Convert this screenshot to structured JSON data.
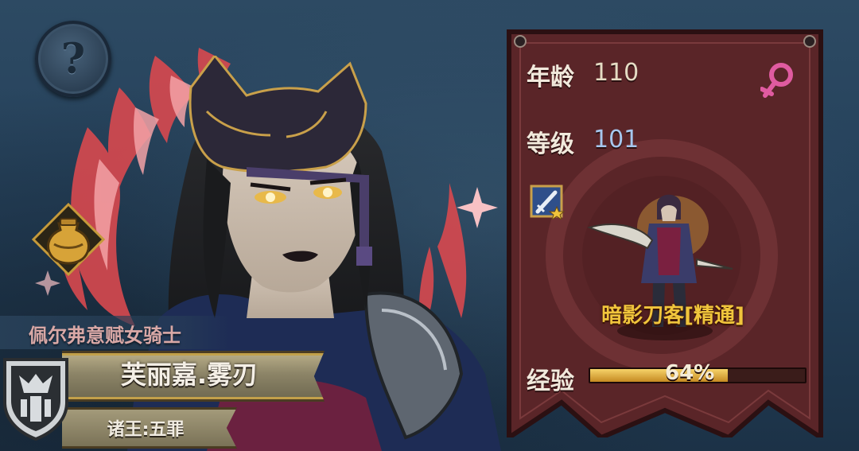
{
  "header": {
    "help_icon": "question-icon"
  },
  "character": {
    "title": "佩尔弗意赋女骑士",
    "name": "芙丽嘉.雾刃",
    "faction": "诸王:五罪",
    "inventory_icon": "potion-bag-icon",
    "faction_icon": "shield-crest-icon"
  },
  "stats": {
    "age_label": "年龄",
    "age_value": "110",
    "gender_icon": "female-icon",
    "level_label": "等级",
    "level_value": "101",
    "skill_icon": "sword-star-icon",
    "class_name": "暗影刀客[精通]",
    "exp_label": "经验",
    "exp_percent_text": "64%",
    "exp_fraction": 0.64
  },
  "colors": {
    "panel_red": "#5a2528",
    "panel_border": "#2b1012",
    "class_gold": "#f0c53c",
    "level_blue": "#a6c7ee",
    "gender_pink": "#e05ba0",
    "title_pink": "#d9a8a6"
  }
}
